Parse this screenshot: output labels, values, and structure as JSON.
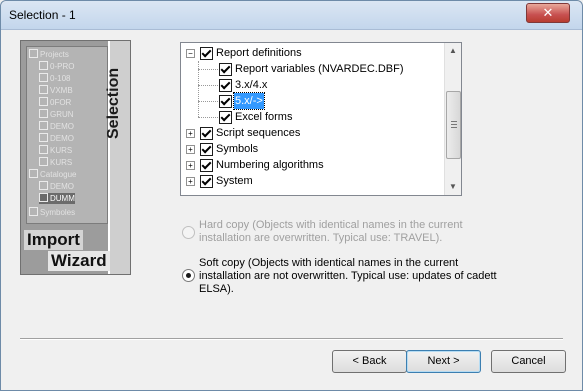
{
  "window": {
    "title": "Selection - 1",
    "close_glyph": "✕"
  },
  "wizard_image": {
    "vertical_text": "Selection",
    "line1": "Import",
    "line2": "Wizard",
    "tree_rows": [
      "Projects",
      "0-PRO",
      "0-108",
      "VXMB",
      "0FOR",
      "GRUN",
      "DEMO",
      "DEMO",
      "KURS",
      "KURS",
      "Catalogue",
      "DEMO",
      "DUMM",
      "Symboles"
    ]
  },
  "tree": {
    "items": [
      {
        "label": "Report definitions",
        "expander": "−",
        "checked": true
      },
      {
        "label": "Report variables (NVARDEC.DBF)",
        "checked": true
      },
      {
        "label": "3.x/4.x",
        "checked": true
      },
      {
        "label": "5.x/->",
        "checked": true,
        "selected": true
      },
      {
        "label": "Excel forms",
        "checked": true
      },
      {
        "label": "Script sequences",
        "expander": "+",
        "checked": true
      },
      {
        "label": "Symbols",
        "expander": "+",
        "checked": true
      },
      {
        "label": "Numbering algorithms",
        "expander": "+",
        "checked": true
      },
      {
        "label": "System",
        "expander": "+",
        "checked": true
      }
    ]
  },
  "options": {
    "hard_copy": {
      "label": "Hard copy (Objects with identical names in the current installation are overwritten. Typical use: TRAVEL).",
      "selected": false,
      "enabled": false
    },
    "soft_copy": {
      "label": "Soft copy (Objects with identical names in the current installation are not overwritten. Typical use: updates of cadett ELSA).",
      "selected": true,
      "enabled": true
    }
  },
  "buttons": {
    "back": "< Back",
    "next": "Next >",
    "cancel": "Cancel"
  },
  "colors": {
    "selection": "#3399ff",
    "title_gradient_top": "#dbe6f3",
    "close_red": "#c75050"
  }
}
